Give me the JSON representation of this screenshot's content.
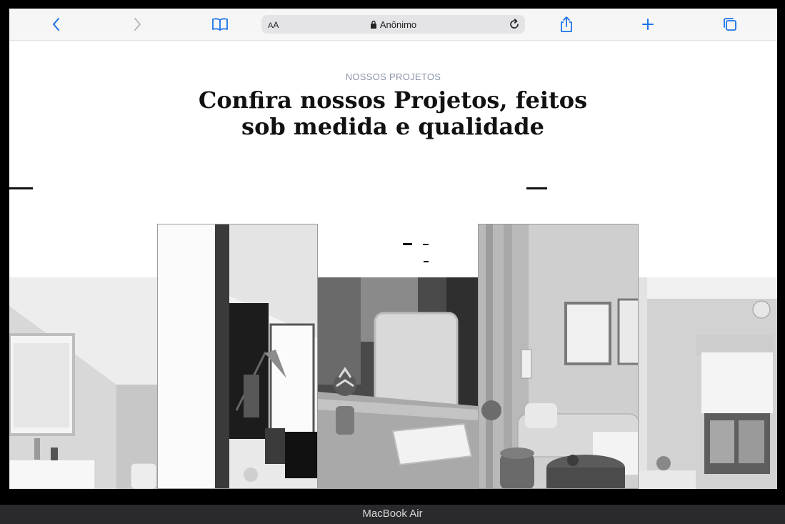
{
  "browser": {
    "address_aa_small": "A",
    "address_aa_big": "A",
    "address_text": "Anônimo",
    "accent": "#1a73e8"
  },
  "page": {
    "section_label": "NOSSOS PROJETOS",
    "heading": "Confira nossos Projetos, feitos sob medida e qualidade"
  },
  "gallery": {
    "images": [
      {
        "name": "bathroom-photo"
      },
      {
        "name": "home-office-photo"
      },
      {
        "name": "table-book-photo"
      },
      {
        "name": "living-room-photo"
      },
      {
        "name": "bedroom-window-photo"
      }
    ]
  },
  "device": {
    "label": "MacBook Air"
  }
}
